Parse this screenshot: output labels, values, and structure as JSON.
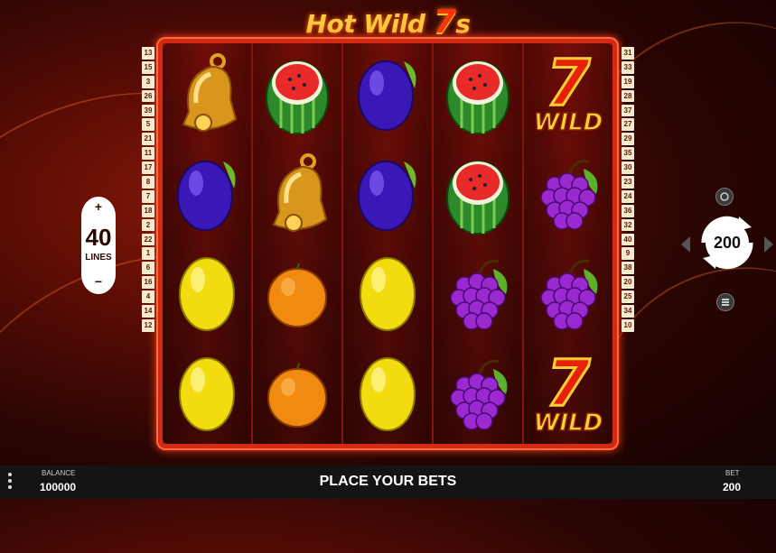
{
  "title": {
    "part1": "Hot Wild ",
    "part2": "7",
    "part3": "s"
  },
  "reels": [
    [
      "bell",
      "plum",
      "lemon",
      "lemon"
    ],
    [
      "watermelon",
      "bell",
      "orange",
      "orange"
    ],
    [
      "plum",
      "plum",
      "lemon",
      "lemon"
    ],
    [
      "watermelon",
      "watermelon",
      "grapes",
      "grapes"
    ],
    [
      "wild",
      "grapes",
      "grapes",
      "wild"
    ]
  ],
  "wild_label": "WILD",
  "seven_label": "7",
  "left_lines": [
    "13",
    "15",
    "3",
    "26",
    "39",
    "5",
    "21",
    "11",
    "17",
    "8",
    "7",
    "18",
    "2",
    "22",
    "1",
    "6",
    "16",
    "4",
    "14",
    "12"
  ],
  "right_lines": [
    "31",
    "33",
    "19",
    "28",
    "37",
    "27",
    "29",
    "35",
    "30",
    "23",
    "24",
    "36",
    "32",
    "40",
    "9",
    "38",
    "20",
    "25",
    "34",
    "10"
  ],
  "lines_control": {
    "plus": "+",
    "value": "40",
    "label": "LINES",
    "minus": "−"
  },
  "spin_control": {
    "value": "200"
  },
  "bottom_bar": {
    "balance_label": "BALANCE",
    "balance_value": "100000",
    "status": "PLACE YOUR BETS",
    "bet_label": "BET",
    "bet_value": "200"
  },
  "colors": {
    "frame": "#d42a14",
    "bar": "#141414",
    "title": "#ffc640"
  }
}
